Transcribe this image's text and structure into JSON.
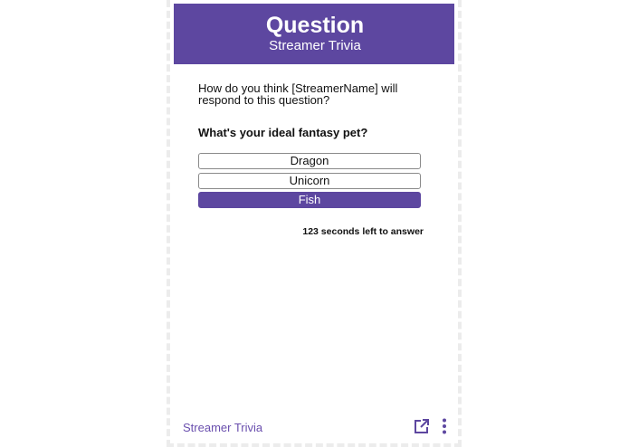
{
  "header": {
    "title": "Question",
    "subtitle": "Streamer Trivia"
  },
  "prompt": "How do you think [StreamerName] will respond to this question?",
  "question": "What's your ideal fantasy pet?",
  "answers": [
    {
      "label": "Dragon",
      "selected": false
    },
    {
      "label": "Unicorn",
      "selected": false
    },
    {
      "label": "Fish",
      "selected": true
    }
  ],
  "timer_text": "123 seconds left to answer",
  "footer": {
    "label": "Streamer Trivia",
    "icons": [
      "external-link-icon",
      "more-vertical-icon"
    ]
  },
  "colors": {
    "accent": "#5d47a0",
    "footer_text": "#6a4fae",
    "frame_border": "#ececec"
  }
}
